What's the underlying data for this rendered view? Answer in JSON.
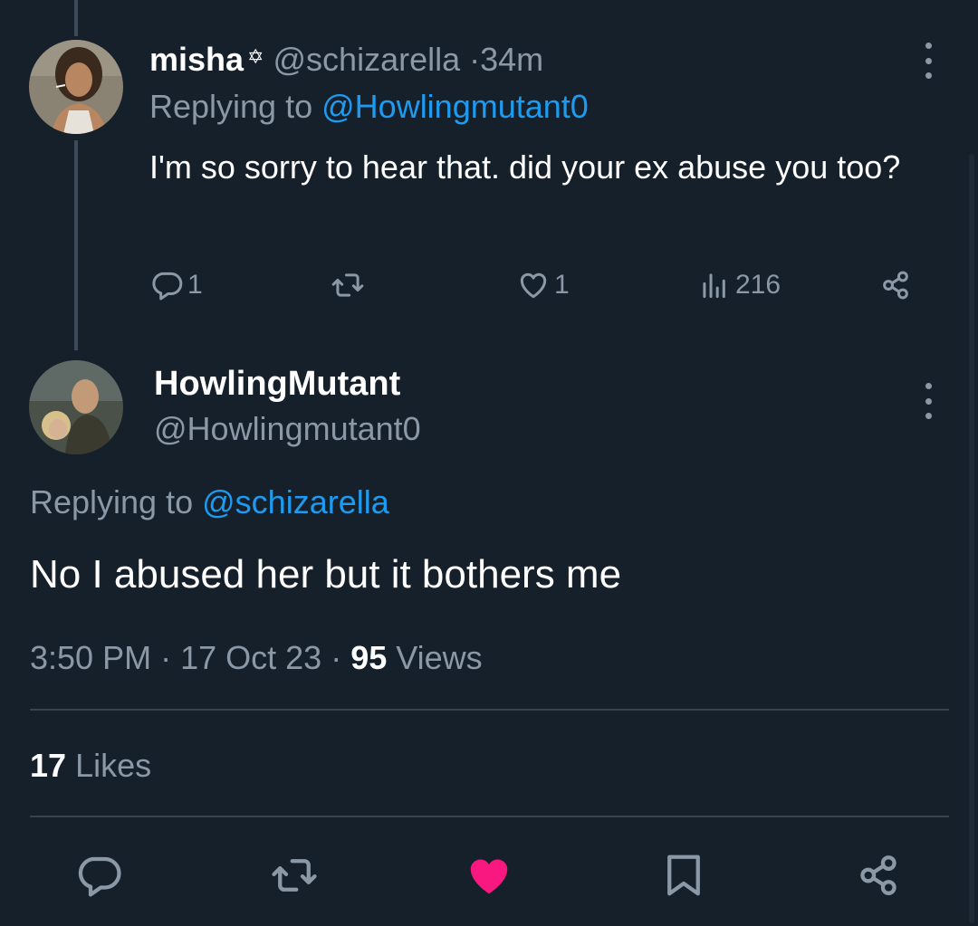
{
  "reply_tweet": {
    "display_name": "misha",
    "badge": "✡",
    "handle": "@schizarella",
    "separator": "·",
    "time": "34m",
    "replying_label": "Replying to",
    "replying_handle": "@Howlingmutant0",
    "body": "I'm so sorry to hear that. did your ex abuse you too?",
    "actions": {
      "reply_count": "1",
      "like_count": "1",
      "views_count": "216"
    }
  },
  "main_tweet": {
    "display_name": "HowlingMutant",
    "handle": "@Howlingmutant0",
    "replying_label": "Replying to",
    "replying_handle": "@schizarella",
    "body": "No I abused her but it bothers me",
    "time": "3:50 PM",
    "date": "17 Oct 23",
    "separator": "·",
    "views_count": "95",
    "views_label": "Views",
    "likes_count": "17",
    "likes_label": "Likes"
  },
  "icons": {
    "reply": "reply-icon",
    "retweet": "retweet-icon",
    "like": "heart-icon",
    "views": "views-chart-icon",
    "share": "share-icon",
    "bookmark": "bookmark-icon",
    "more": "more-options-icon"
  },
  "colors": {
    "background": "#15202b",
    "accent": "#1d9bf0",
    "muted": "#8b98a5",
    "liked": "#f91880"
  }
}
